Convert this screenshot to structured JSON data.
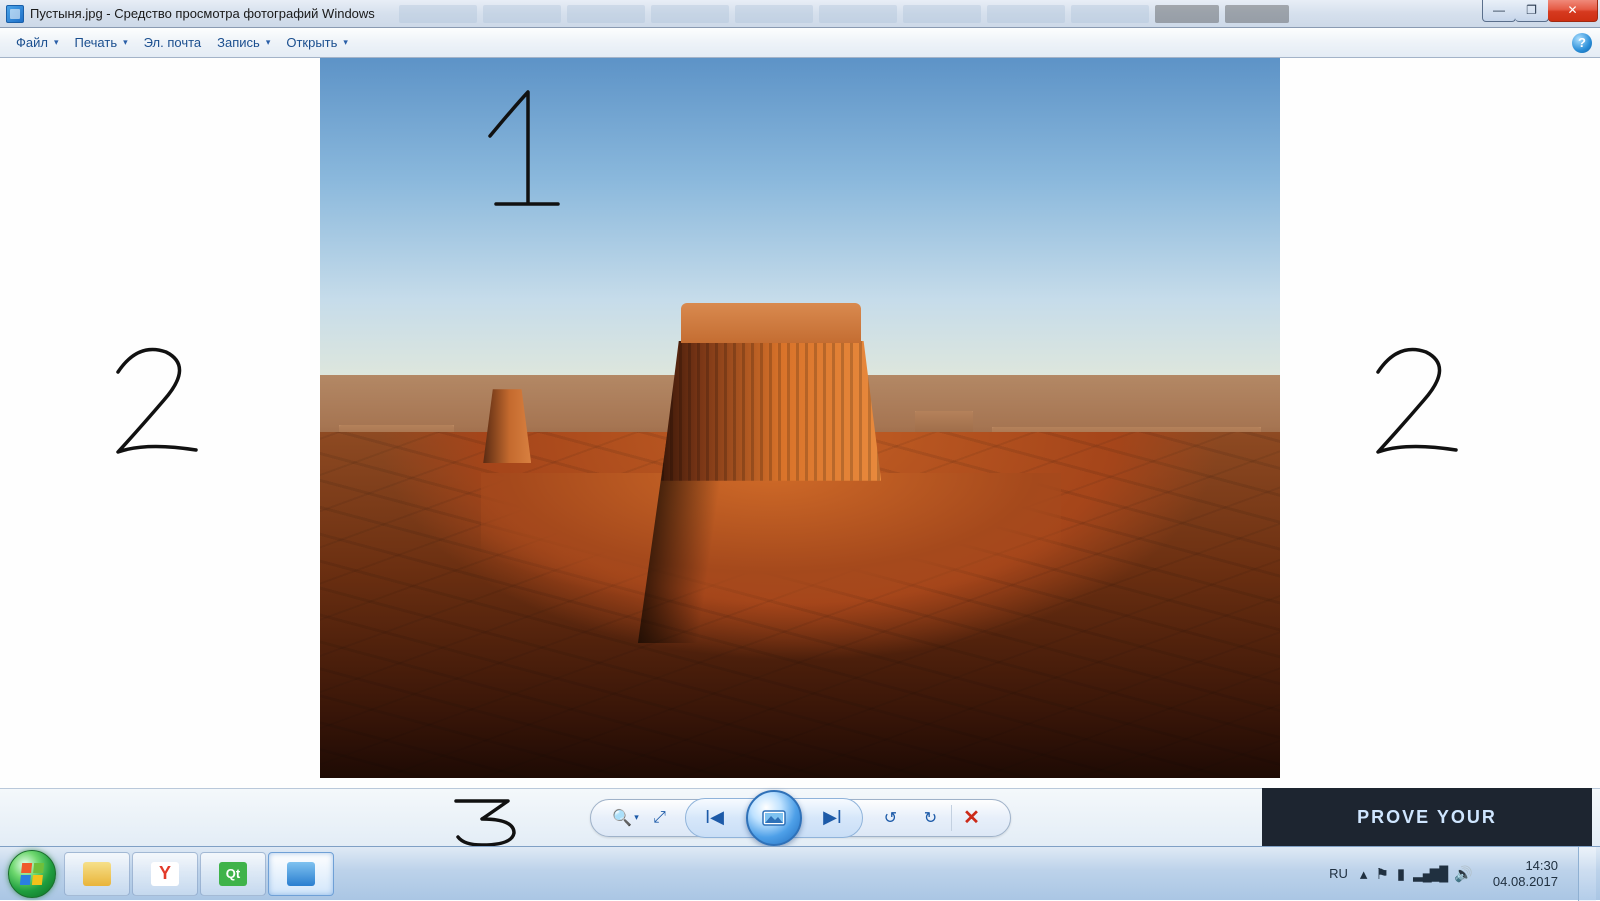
{
  "titlebar": {
    "title": "Пустыня.jpg - Средство просмотра фотографий Windows"
  },
  "toolbar": {
    "file": "Файл",
    "print": "Печать",
    "email": "Эл. почта",
    "burn": "Запись",
    "open": "Открыть"
  },
  "annotations": {
    "top": "1",
    "left": "2",
    "right": "2",
    "bottom": "3"
  },
  "bottom_ad": "PROVE YOUR",
  "tray": {
    "lang": "RU",
    "time": "14:30",
    "date": "04.08.2017"
  },
  "icons": {
    "minimize": "—",
    "maximize": "❐",
    "close": "✕",
    "help": "?",
    "dropdown": "▾",
    "zoom": "🔍",
    "fit": "⤢",
    "prev": "I◀",
    "next": "▶I",
    "ccw": "↺",
    "cw": "↻",
    "delete": "✕",
    "tray_up": "▴",
    "flag": "⚑",
    "battery": "▮",
    "wifi": "▮",
    "sound": "🔊"
  }
}
